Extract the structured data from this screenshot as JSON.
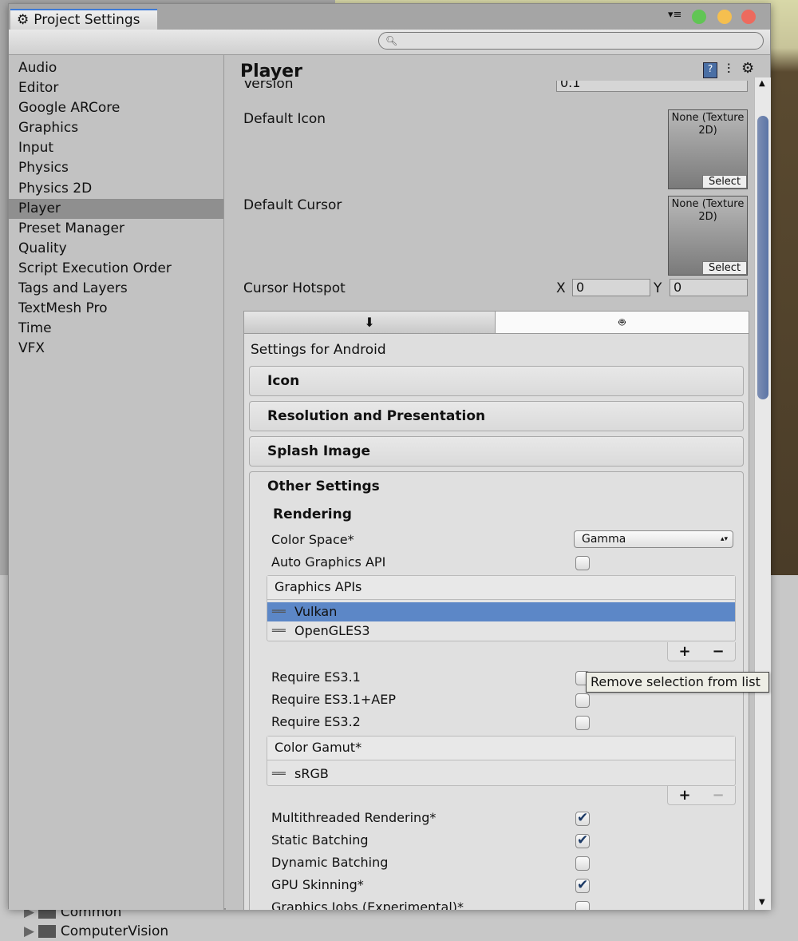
{
  "background": {
    "project_items": [
      "Common",
      "ComputerVision"
    ]
  },
  "window": {
    "tab_title": "Project Settings",
    "search": {
      "value": "",
      "placeholder": ""
    }
  },
  "colors": {
    "close": "#ed6a5e",
    "minimize": "#f5bf4f",
    "maximize": "#61c554",
    "selection": "#5c87c7"
  },
  "sidebar": {
    "items": [
      {
        "label": "Audio"
      },
      {
        "label": "Editor"
      },
      {
        "label": "Google ARCore"
      },
      {
        "label": "Graphics"
      },
      {
        "label": "Input"
      },
      {
        "label": "Physics"
      },
      {
        "label": "Physics 2D"
      },
      {
        "label": "Player",
        "selected": true
      },
      {
        "label": "Preset Manager"
      },
      {
        "label": "Quality"
      },
      {
        "label": "Script Execution Order"
      },
      {
        "label": "Tags and Layers"
      },
      {
        "label": "TextMesh Pro"
      },
      {
        "label": "Time"
      },
      {
        "label": "VFX"
      }
    ]
  },
  "player": {
    "title": "Player",
    "version_label": "Version",
    "version_value": "0.1",
    "default_icon": {
      "label": "Default Icon",
      "value": "None (Texture 2D)",
      "button": "Select"
    },
    "default_cursor": {
      "label": "Default Cursor",
      "value": "None (Texture 2D)",
      "button": "Select"
    },
    "cursor_hotspot": {
      "label": "Cursor Hotspot",
      "x_label": "X",
      "x": "0",
      "y_label": "Y",
      "y": "0"
    },
    "platform_tabs": [
      {
        "icon": "download-icon",
        "active": false
      },
      {
        "icon": "android-icon",
        "active": true
      }
    ],
    "settings_for": "Settings for Android",
    "sections": [
      "Icon",
      "Resolution and Presentation",
      "Splash Image",
      "Other Settings"
    ],
    "rendering": {
      "heading": "Rendering",
      "color_space": {
        "label": "Color Space*",
        "value": "Gamma"
      },
      "auto_graphics_api": {
        "label": "Auto Graphics API",
        "checked": false
      },
      "graphics_apis": {
        "header": "Graphics APIs",
        "items": [
          "Vulkan",
          "OpenGLES3"
        ],
        "selected": "Vulkan"
      },
      "require": [
        {
          "label": "Require ES3.1",
          "checked": false
        },
        {
          "label": "Require ES3.1+AEP",
          "checked": false
        },
        {
          "label": "Require ES3.2",
          "checked": false
        }
      ],
      "color_gamut": {
        "header": "Color Gamut*",
        "items": [
          "sRGB"
        ]
      },
      "options": [
        {
          "label": "Multithreaded Rendering*",
          "checked": true
        },
        {
          "label": "Static Batching",
          "checked": true
        },
        {
          "label": "Dynamic Batching",
          "checked": false
        },
        {
          "label": "GPU Skinning*",
          "checked": true
        },
        {
          "label": "Graphics Jobs (Experimental)*",
          "checked": false
        }
      ]
    }
  },
  "list_buttons": {
    "add": "+",
    "remove": "−"
  },
  "tooltip": "Remove selection from list"
}
